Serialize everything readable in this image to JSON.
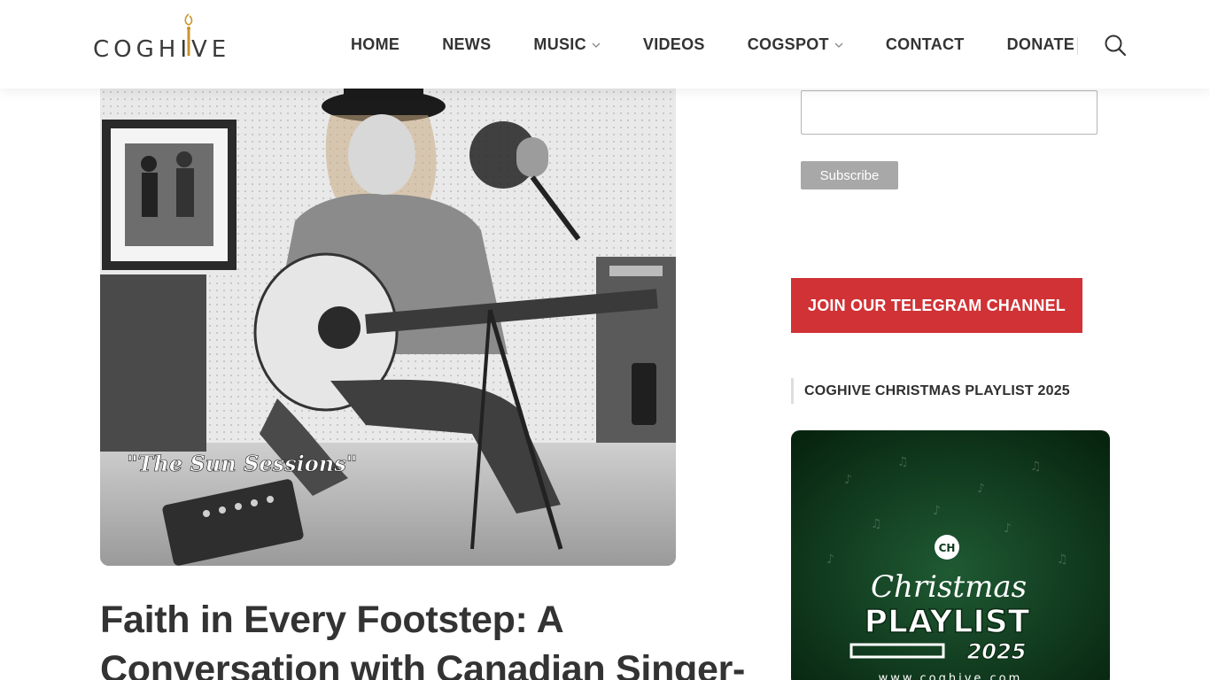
{
  "header": {
    "logo_text": "COGHIVE",
    "nav": [
      {
        "label": "HOME",
        "has_dropdown": false
      },
      {
        "label": "NEWS",
        "has_dropdown": false
      },
      {
        "label": "MUSIC",
        "has_dropdown": true
      },
      {
        "label": "VIDEOS",
        "has_dropdown": false
      },
      {
        "label": "COGSPOT",
        "has_dropdown": true
      },
      {
        "label": "CONTACT",
        "has_dropdown": false
      },
      {
        "label": "DONATE",
        "has_dropdown": false
      }
    ],
    "search_icon": "search-icon"
  },
  "article": {
    "hero_caption": "\"The Sun Sessions\"",
    "title": "Faith in Every Footstep: A Conversation with Canadian Singer-"
  },
  "sidebar": {
    "email_value": "",
    "subscribe_label": "Subscribe",
    "telegram_label": "JOIN OUR TELEGRAM CHANNEL",
    "playlist_widget_title": "COGHIVE CHRISTMAS PLAYLIST 2025",
    "playlist_card": {
      "badge": "CH",
      "script_word": "Christmas",
      "word": "PLAYLIST",
      "year": "2025",
      "url": "www.coghive.com"
    }
  },
  "colors": {
    "accent_red": "#d03235",
    "logo_gold": "#c9962b",
    "text_dark": "#333333",
    "playlist_green": "#0f3a1f",
    "button_gray": "#a8a8a8"
  }
}
